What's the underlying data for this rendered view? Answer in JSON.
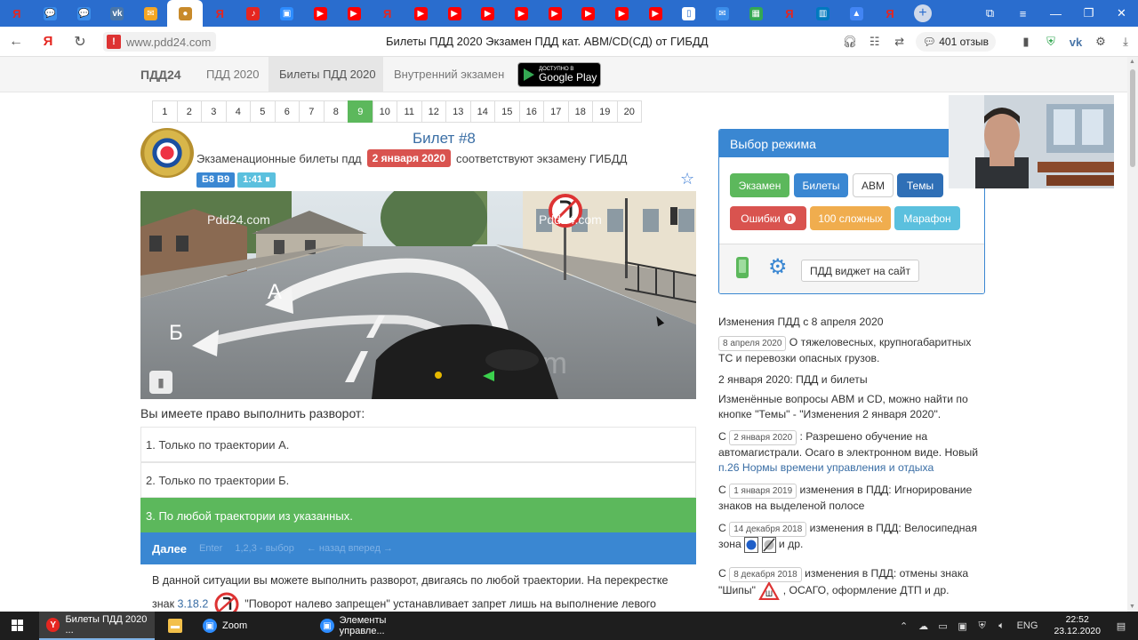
{
  "browser": {
    "tabs": [
      {
        "icon": "yandex-icon",
        "glyph": "Я",
        "color": "#e52620"
      },
      {
        "icon": "chat-icon",
        "glyph": "💬",
        "color": "#3b8dea"
      },
      {
        "icon": "chat-icon",
        "glyph": "💬",
        "color": "#3b8dea"
      },
      {
        "icon": "vk-icon",
        "glyph": "vk",
        "color": "#4a76a8"
      },
      {
        "icon": "mail-icon",
        "glyph": "✉",
        "color": "#f5a623"
      },
      {
        "icon": "pdd-icon",
        "glyph": "●",
        "color": "#c88a2a",
        "active": true
      },
      {
        "icon": "yandex-icon",
        "glyph": "Я",
        "color": "#e52620"
      },
      {
        "icon": "music-icon",
        "glyph": "♪",
        "color": "#e52620"
      },
      {
        "icon": "zoom-icon",
        "glyph": "▣",
        "color": "#2d8cff"
      },
      {
        "icon": "youtube-icon",
        "glyph": "▶",
        "color": "#ff0000"
      },
      {
        "icon": "youtube-icon",
        "glyph": "▶",
        "color": "#ff0000"
      },
      {
        "icon": "yandex-icon",
        "glyph": "Я",
        "color": "#e52620"
      },
      {
        "icon": "youtube-icon",
        "glyph": "▶",
        "color": "#ff0000"
      },
      {
        "icon": "youtube-icon",
        "glyph": "▶",
        "color": "#ff0000"
      },
      {
        "icon": "youtube-icon",
        "glyph": "▶",
        "color": "#ff0000"
      },
      {
        "icon": "youtube-icon",
        "glyph": "▶",
        "color": "#ff0000"
      },
      {
        "icon": "youtube-icon",
        "glyph": "▶",
        "color": "#ff0000"
      },
      {
        "icon": "youtube-icon",
        "glyph": "▶",
        "color": "#ff0000"
      },
      {
        "icon": "youtube-icon",
        "glyph": "▶",
        "color": "#ff0000"
      },
      {
        "icon": "youtube-icon",
        "glyph": "▶",
        "color": "#ff0000"
      },
      {
        "icon": "document-icon",
        "glyph": "▯",
        "color": "#ffffff"
      },
      {
        "icon": "mail-icon",
        "glyph": "✉",
        "color": "#3b8dea"
      },
      {
        "icon": "sheet-icon",
        "glyph": "▦",
        "color": "#34a853"
      },
      {
        "icon": "yandex-icon",
        "glyph": "Я",
        "color": "#e52620"
      },
      {
        "icon": "trello-icon",
        "glyph": "▥",
        "color": "#0079bf"
      },
      {
        "icon": "drive-icon",
        "glyph": "▲",
        "color": "#4285f4"
      },
      {
        "icon": "yandex-icon",
        "glyph": "Я",
        "color": "#e52620"
      }
    ],
    "url": "www.pdd24.com",
    "page_title": "Билеты ПДД 2020 Экзамен ПДД кат. ABM/CD(СД) от ГИБДД",
    "reviews": "401 отзыв"
  },
  "site": {
    "brand": "ПДД24",
    "nav": [
      "ПДД 2020",
      "Билеты ПДД 2020",
      "Внутренний экзамен"
    ],
    "gplay_small": "ДОСТУПНО В",
    "gplay_big": "Google Play"
  },
  "pagination": {
    "pages": [
      "1",
      "2",
      "3",
      "4",
      "5",
      "6",
      "7",
      "8",
      "9",
      "10",
      "11",
      "12",
      "13",
      "14",
      "15",
      "16",
      "17",
      "18",
      "19",
      "20"
    ],
    "active": 8
  },
  "ticket": {
    "title": "Билет #8",
    "subtitle_pre": "Экзаменационные билеты пдд",
    "date_badge": "2 января 2020",
    "subtitle_post": "соответствуют экзамену ГИБДД",
    "badge_ticket": "Б8 В9",
    "badge_ticket_color": "#3a87d2",
    "badge_time": "1:41 ⏸",
    "badge_time_color": "#5bc0de",
    "image_watermark": "Pdd24.com",
    "route_a": "А",
    "route_b": "Б",
    "question": "Вы имеете право выполнить разворот:",
    "answers": [
      {
        "text": "1. Только по траектории А.",
        "correct": false
      },
      {
        "text": "2. Только по траектории Б.",
        "correct": false
      },
      {
        "text": "3. По любой траектории из указанных.",
        "correct": true
      }
    ],
    "next_label": "Далее",
    "hint_enter": "Enter",
    "hint_select": "1,2,3 - выбор",
    "hint_nav": "← назад вперед →",
    "explanation_1": "В данной ситуации вы можете выполнить разворот, двигаясь по любой траектории. На перекрестке",
    "explanation_2a": "знак",
    "explanation_link": "3.18.2",
    "explanation_2b": "\"Поворот налево запрещен\" устанавливает запрет лишь на выполнение левого"
  },
  "mode_panel": {
    "title": "Выбор режима",
    "buttons": [
      {
        "label": "Экзамен",
        "color": "#5cb85c"
      },
      {
        "label": "Билеты",
        "color": "#3a87d2"
      },
      {
        "label": "ABM",
        "color": "#ffffff"
      },
      {
        "label": "Темы",
        "color": "#2f6fb6"
      },
      {
        "label": "Ошибки",
        "color": "#d9534f",
        "count": "0"
      },
      {
        "label": "100 сложных",
        "color": "#f0ad4e"
      },
      {
        "label": "Марафон",
        "color": "#5bc0de"
      }
    ],
    "widget_button": "ПДД виджет на сайт"
  },
  "news": {
    "heading": "Изменения ПДД с 8 апреля 2020",
    "item1_date": "8 апреля 2020",
    "item1_text": "О тяжеловесных, крупногабаритных ТС и перевозки опасных грузов.",
    "item2_heading": "2 января 2020: ПДД и билеты",
    "item2_text": "Изменённые вопросы ABM и CD, можно найти по кнопке \"Темы\" - \"Изменения 2 января 2020\".",
    "prefix": "С",
    "item3_date": "2 января 2020",
    "item3_text": ": Разрешено обучение на автомагистрали. Осаго в электронном виде. Новый",
    "item3_link": "п.26 Нормы времени управления и отдыха",
    "item4_date": "1 января 2019",
    "item4_text": "изменения в ПДД: Игнорирование знаков на выделеной полосе",
    "item5_date": "14 декабря 2018",
    "item5_text": "изменения в ПДД: Велосипедная зона",
    "item5_tail": "и др.",
    "item6_date": "8 декабря 2018",
    "item6_text": "изменения в ПДД: отмены знака \"Шипы\"",
    "item6_tail": ", ОСАГО, оформление ДТП и др."
  },
  "taskbar": {
    "tasks": [
      {
        "label": "Билеты ПДД 2020 ...",
        "icon": "yandex-browser-icon",
        "color": "#e52620",
        "glyph": "Y",
        "active": true
      },
      {
        "label": "",
        "icon": "folder-icon",
        "color": "#f3c04a",
        "glyph": "▬",
        "active": false
      },
      {
        "label": "Zoom",
        "icon": "zoom-icon",
        "color": "#2d8cff",
        "glyph": "▣",
        "active": false
      },
      {
        "label": "Элементы управле...",
        "icon": "zoom-icon",
        "color": "#2d8cff",
        "glyph": "▣",
        "active": false
      }
    ],
    "lang": "ENG",
    "time": "22:52",
    "date": "23.12.2020"
  }
}
